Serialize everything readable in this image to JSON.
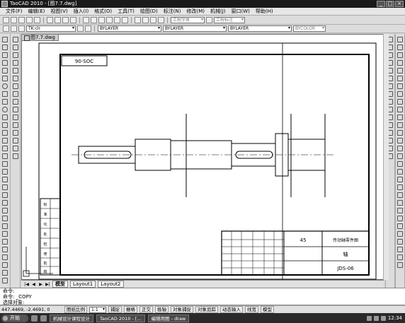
{
  "window": {
    "title": "TaoCAD 2010 - [图7.7.dwg]"
  },
  "menu": [
    "文件(F)",
    "编辑(E)",
    "视图(V)",
    "插入(I)",
    "格式(O)",
    "工具(T)",
    "绘图(D)",
    "标注(N)",
    "修改(M)",
    "机械(J)",
    "窗口(W)",
    "帮助(H)"
  ],
  "toolbar": {
    "text_style": "工程字体",
    "dim_style": "工程标注",
    "layer": "TK:clr",
    "linetype1": "BYLAYER",
    "linetype2": "BYLAYER",
    "lineweight": "BYLAYER",
    "color_field": "BYCOLOR"
  },
  "document": {
    "tab_title": "图7.7.dwg",
    "corner_label": "90-SOC",
    "drawing_number": "JDS-06",
    "title_part": "传动轴零件图",
    "material": "45",
    "scale_label": "轴",
    "side_block_rows": [
      "标",
      "准",
      "化",
      "处",
      "检",
      "修",
      "批",
      "核"
    ]
  },
  "layout_tabs": {
    "model": "模型",
    "layout1": "Layout1",
    "layout2": "Layout2"
  },
  "command": {
    "line1": "命令:",
    "line2": "命令: _COPY",
    "line3": "选择对象:"
  },
  "status": {
    "coords": "447.4469, -2.4691, 0",
    "scale_label": "图纸比例",
    "scale_value": "1:1",
    "toggles": [
      "捕捉",
      "栅格",
      "正交",
      "极轴",
      "对象捕捉",
      "对象追踪",
      "动态输入",
      "线宽",
      "模型"
    ]
  },
  "taskbar": {
    "start": "开始",
    "tasks": [
      "机械设计课程设计",
      "TaoCAD 2010 - [...",
      "编辑用图 - draw"
    ],
    "clock": "12:34"
  }
}
